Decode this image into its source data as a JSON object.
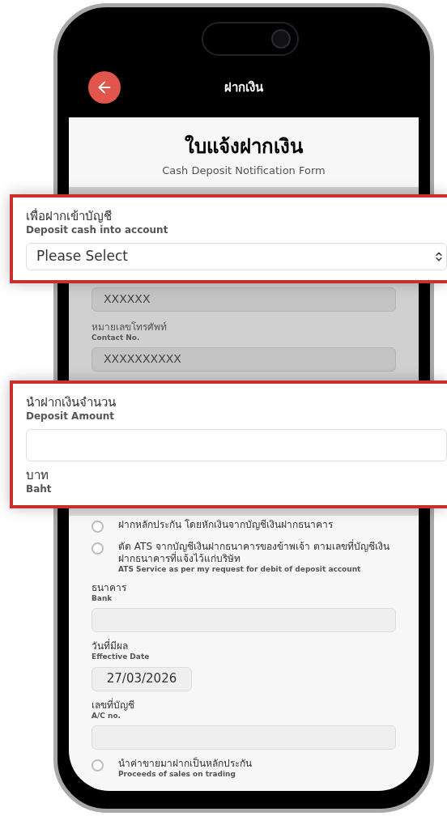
{
  "header": {
    "title": "ฝากเงิน"
  },
  "form": {
    "title": "ใบแจ้งฝากเงิน",
    "subtitle": "Cash Deposit Notification Form"
  },
  "upper_items": [
    {
      "kind": "field",
      "value": "XXXXXX"
    },
    {
      "kind": "field",
      "label_th": "หมายเลขโทรศัพท์",
      "label_en": "Contact No.",
      "value": "XXXXXXXXXX"
    }
  ],
  "lower_items": [
    {
      "kind": "radio",
      "selected": false,
      "label_th": "ฝากหลักประกัน โดยหักเงินจากบัญชีเงินฝากธนาคาร"
    },
    {
      "kind": "radio",
      "selected": false,
      "label_th": "ตัด ATS จากบัญชีเงินฝากธนาคารของข้าพเจ้า ตามเลขที่บัญชีเงินฝากธนาคารที่แจ้งไว้แก่บริษัท",
      "label_en": "ATS Service as per my request for debit of deposit account"
    },
    {
      "kind": "field",
      "label_th": "ธนาคาร",
      "label_en": "Bank"
    },
    {
      "kind": "date",
      "label_th": "วันที่มีผล",
      "label_en": "Effective Date",
      "value": "27/03/2026"
    },
    {
      "kind": "field",
      "label_th": "เลขที่บัญชี",
      "label_en": "A/C no."
    },
    {
      "kind": "radio",
      "selected": false,
      "label_th": "นำค่าขายมาฝากเป็นหลักประกัน",
      "label_en": "Proceeds of sales on trading"
    }
  ],
  "callouts": [
    {
      "kind": "select",
      "label_th": "เพื่อฝากเข้าบัญชี",
      "label_en": "Deposit cash into account",
      "value": "Please Select"
    },
    {
      "kind": "amount",
      "label_th": "นำฝากเงินจำนวน",
      "label_en": "Deposit Amount",
      "unit_th": "บาท",
      "unit_en": "Baht"
    }
  ]
}
